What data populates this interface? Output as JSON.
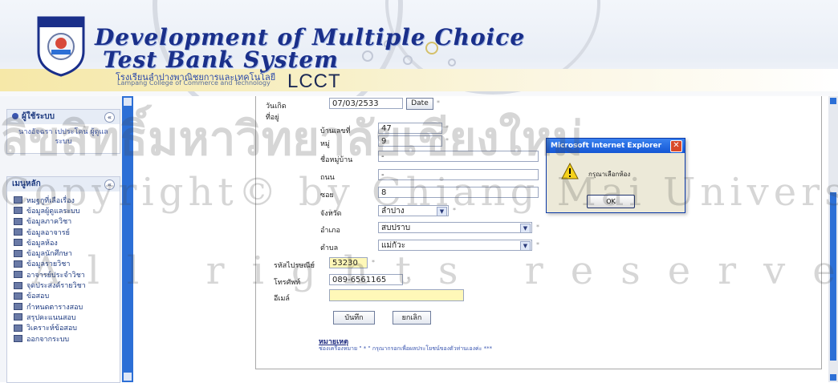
{
  "header": {
    "title_line1": "Development of Multiple Choice",
    "title_line2": "Test Bank System",
    "school_thai": "โรงเรียนลำปางพาณิชยการและเทคโนโลยี",
    "school_en": "Lampang College of Commerce and Technology",
    "brand": "LCCT"
  },
  "sidebar": {
    "user_panel": {
      "title": "ผู้ใช้ระบบ",
      "toggle": "«",
      "name": "นางอัจฉรา เปประโคน ผู้ดูแลระบบ"
    },
    "menu_panel": {
      "title": "เมนูหลัก",
      "toggle": "«",
      "items": [
        "หมฐกูที่เลือเรื่อง",
        "ข้อมูลผู้ดูแลระบบ",
        "ข้อมูลภาควิชา",
        "ข้อมูลอาจารย์",
        "ข้อมูลห้อง",
        "ข้อมูลนักศึกษา",
        "ข้อมูลรายวิชา",
        "อาจารย์ประจำวิชา",
        "จุดประสงค์รายวิชา",
        "ข้อสอบ",
        "กำหนดตารางสอบ",
        "สรุปคะแนนสอบ",
        "วิเคราะห์ข้อสอบ",
        "ออกจากระบบ"
      ]
    }
  },
  "form": {
    "birthdate_label": "วันเกิด",
    "birthdate_value": "07/03/2533",
    "date_button": "Date",
    "address_label": "ที่อยู่",
    "house_no_label": "บ้านเลขที่",
    "house_no_value": "47",
    "moo_label": "หมู่",
    "moo_value": "9",
    "village_label": "ชื่อหมู่บ้าน",
    "village_value": "-",
    "road_label": "ถนน",
    "road_value": "-",
    "soi_label": "ซอย",
    "soi_value": "8",
    "province_label": "จังหวัด",
    "province_value": "ลำปาง",
    "district_label": "อำเภอ",
    "district_value": "สบปราบ",
    "subdistrict_label": "ตำบล",
    "subdistrict_value": "แม่กัวะ",
    "postal_label": "รหัสไปรษณีย์",
    "postal_value": "53230",
    "phone_label": "โทรศัพท์",
    "phone_value": "089-6561165",
    "email_label": "อีเมล์",
    "email_value": "",
    "save_button": "บันทึก",
    "cancel_button": "ยกเลิก",
    "note_title": "หมายเหตุ",
    "note_text": "ช่องเครื่องหมาย \" * \" กรุณากรอกเพื่อผลประโยชน์ของตัวท่านเองค่ะ ***",
    "required_mark": "*"
  },
  "dialog": {
    "title": "Microsoft Internet Explorer",
    "close": "✕",
    "message": "กรุณาเลือกห้อง",
    "ok_button": "OK"
  },
  "watermark": {
    "line1": "ลิขสิทธิ์มหาวิทยาลัยเชียงใหม่",
    "line2": "Copyright© by Chiang Mai University",
    "line3": "All rights reserved"
  },
  "colors": {
    "accent_blue": "#2c6fd6",
    "title_navy": "#1a2f8a",
    "input_yellow": "#fff8b8"
  }
}
